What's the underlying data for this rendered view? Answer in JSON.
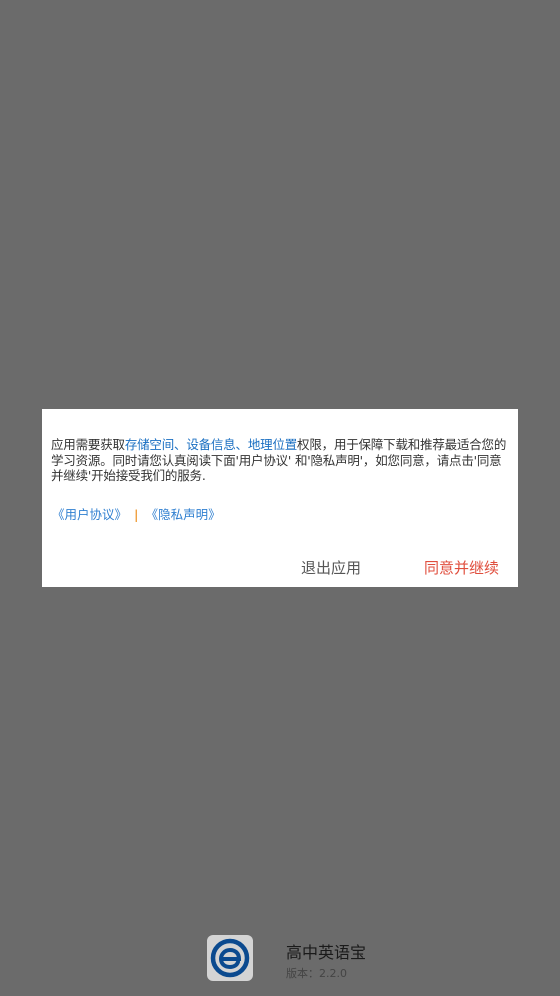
{
  "dialog": {
    "message_prefix": "应用需要获取",
    "perm_storage": "存储空间",
    "sep1": "、",
    "perm_device": "设备信息",
    "sep2": "、",
    "perm_location": "地理位置",
    "message_suffix": "权限，用于保障下载和推荐最适合您的学习资源。同时请您认真阅读下面'用户协议' 和'隐私声明'，如您同意，请点击'同意并继续'开始接受我们的服务.",
    "link_user_agreement": "《用户协议》",
    "link_separator": "|",
    "link_privacy": "《隐私声明》",
    "exit_label": "退出应用",
    "agree_label": "同意并继续"
  },
  "app": {
    "name": "高中英语宝",
    "version": "版本：2.2.0",
    "logo_icon": "e-logo-icon"
  },
  "colors": {
    "overlay": "#6b6b6b",
    "link": "#2f7fd0",
    "agree": "#e04e3d",
    "logo_blue": "#0b4a8f"
  }
}
